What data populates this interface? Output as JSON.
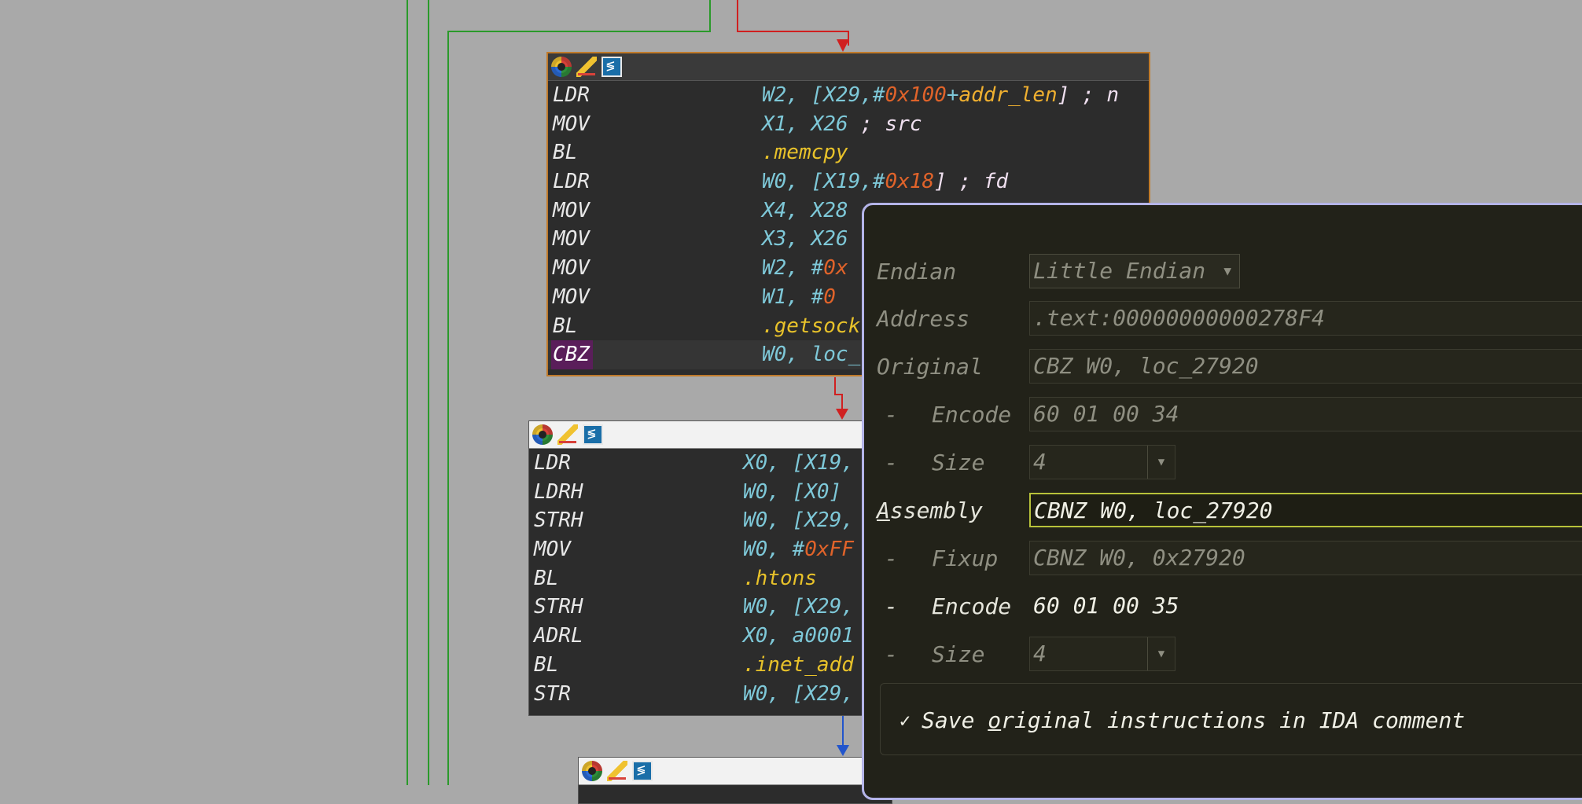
{
  "block1": {
    "lines": [
      {
        "mn": "LDR",
        "parts": [
          {
            "t": "W2, [X29,#",
            "c": "reg"
          },
          {
            "t": "0x100",
            "c": "num"
          },
          {
            "t": "+",
            "c": "reg"
          },
          {
            "t": "addr_len",
            "c": "sym"
          },
          {
            "t": "] ; n",
            "c": "cm"
          }
        ]
      },
      {
        "mn": "MOV",
        "parts": [
          {
            "t": "X1, X26 ",
            "c": "reg"
          },
          {
            "t": "; src",
            "c": "cm"
          }
        ]
      },
      {
        "mn": "BL",
        "parts": [
          {
            "t": ".memcpy",
            "c": "fn"
          }
        ]
      },
      {
        "mn": "LDR",
        "parts": [
          {
            "t": "W0, [X19,#",
            "c": "reg"
          },
          {
            "t": "0x18",
            "c": "num"
          },
          {
            "t": "] ; fd",
            "c": "cm"
          }
        ]
      },
      {
        "mn": "MOV",
        "parts": [
          {
            "t": "X4, X28",
            "c": "reg"
          }
        ]
      },
      {
        "mn": "MOV",
        "parts": [
          {
            "t": "X3, X26",
            "c": "reg"
          }
        ]
      },
      {
        "mn": "MOV",
        "parts": [
          {
            "t": "W2, #",
            "c": "reg"
          },
          {
            "t": "0x",
            "c": "num"
          }
        ]
      },
      {
        "mn": "MOV",
        "parts": [
          {
            "t": "W1, #",
            "c": "reg"
          },
          {
            "t": "0",
            "c": "num"
          }
        ]
      },
      {
        "mn": "BL",
        "parts": [
          {
            "t": ".getsock",
            "c": "fn"
          }
        ]
      },
      {
        "mn": "CBZ",
        "selected": true,
        "parts": [
          {
            "t": "W0, loc_",
            "c": "reg"
          }
        ]
      }
    ]
  },
  "block2": {
    "lines": [
      {
        "mn": "LDR",
        "parts": [
          {
            "t": "X0, [X19,",
            "c": "reg"
          }
        ]
      },
      {
        "mn": "LDRH",
        "parts": [
          {
            "t": "W0, [X0]",
            "c": "reg"
          }
        ]
      },
      {
        "mn": "STRH",
        "parts": [
          {
            "t": "W0, [X29,",
            "c": "reg"
          }
        ]
      },
      {
        "mn": "MOV",
        "parts": [
          {
            "t": "W0, #",
            "c": "reg"
          },
          {
            "t": "0xFF",
            "c": "num"
          }
        ]
      },
      {
        "mn": "BL",
        "parts": [
          {
            "t": ".htons",
            "c": "fn"
          }
        ]
      },
      {
        "mn": "STRH",
        "parts": [
          {
            "t": "W0, [X29,",
            "c": "reg"
          }
        ]
      },
      {
        "mn": "ADRL",
        "parts": [
          {
            "t": "X0, a0001",
            "c": "reg"
          }
        ]
      },
      {
        "mn": "BL",
        "parts": [
          {
            "t": ".inet_add",
            "c": "fn"
          }
        ]
      },
      {
        "mn": "STR",
        "parts": [
          {
            "t": "W0, [X29,",
            "c": "reg"
          }
        ]
      }
    ]
  },
  "dialog": {
    "endian_label": "Endian",
    "endian_value": "Little Endian",
    "address_label": "Address",
    "address_value": ".text:00000000000278F4",
    "original_label": "Original",
    "original_value": "CBZ W0, loc_27920",
    "orig_encode_label": "Encode",
    "orig_encode_value": "60 01 00 34",
    "orig_size_label": "Size",
    "orig_size_value": "4",
    "assembly_label_first": "A",
    "assembly_label_rest": "ssembly",
    "assembly_value": "CBNZ W0, loc_27920",
    "fixup_label": "Fixup",
    "fixup_value": "CBNZ W0, 0x27920",
    "new_encode_label": "Encode",
    "new_encode_value": "60 01 00 35",
    "new_size_label": "Size",
    "new_size_value": "4",
    "dash": "-",
    "checkbox_mark": "✓",
    "checkbox_label_a": "Save ",
    "checkbox_label_u": "o",
    "checkbox_label_b": "riginal instructions in IDA comment"
  }
}
